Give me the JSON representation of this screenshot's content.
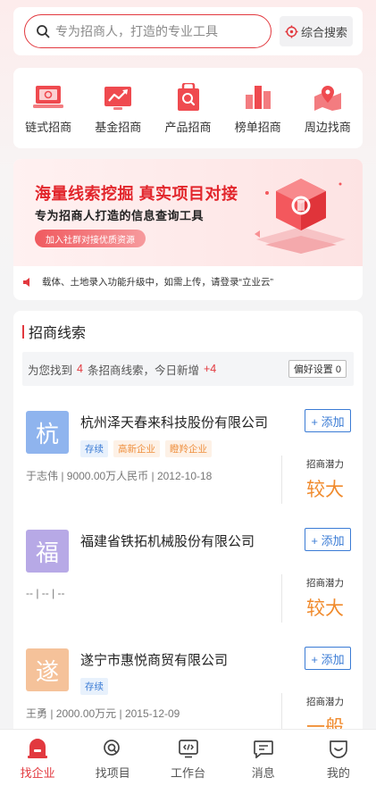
{
  "search": {
    "placeholder": "专为招商人，打造的专业工具",
    "combo_label": "综合搜索"
  },
  "categories": [
    {
      "label": "链式招商",
      "icon": "laptop-icon"
    },
    {
      "label": "基金招商",
      "icon": "trend-chart-icon"
    },
    {
      "label": "产品招商",
      "icon": "product-search-icon"
    },
    {
      "label": "榜单招商",
      "icon": "bar-chart-icon"
    },
    {
      "label": "周边找商",
      "icon": "map-pin-icon"
    }
  ],
  "banner": {
    "title": "海量线索挖掘 真实项目对接",
    "subtitle": "专为招商人打造的信息查询工具",
    "button_label": "加入社群对接优质资源",
    "notice": "载体、土地录入功能升级中，如需上传，请登录“立业云”"
  },
  "leads": {
    "section_title": "招商线索",
    "summary_prefix": "为您找到",
    "found_count": "4",
    "summary_middle": "条招商线索，今日新增",
    "new_count": "+4",
    "pref_button": "偏好设置 0",
    "add_label": "+ 添加",
    "potential_label": "招商潜力",
    "items": [
      {
        "avatar_char": "杭",
        "avatar_color": "#8fb4ee",
        "name": "杭州泽天春来科技股份有限公司",
        "tags": [
          "存续",
          "高新企业",
          "瞪羚企业"
        ],
        "meta": "于志伟 | 9000.00万人民币 | 2012-10-18",
        "potential": "较大"
      },
      {
        "avatar_char": "福",
        "avatar_color": "#b7a9e6",
        "name": "福建省铁拓机械股份有限公司",
        "tags": [],
        "meta": "-- | -- | --",
        "potential": "较大"
      },
      {
        "avatar_char": "遂",
        "avatar_color": "#f5c29a",
        "name": "遂宁市惠悦商贸有限公司",
        "tags": [
          "存续"
        ],
        "meta": "王勇 | 2000.00万元 | 2015-12-09",
        "potential": "一般"
      }
    ]
  },
  "tabbar": [
    {
      "label": "找企业",
      "icon": "company-icon",
      "active": true
    },
    {
      "label": "找项目",
      "icon": "project-search-icon",
      "active": false
    },
    {
      "label": "工作台",
      "icon": "workbench-icon",
      "active": false
    },
    {
      "label": "消息",
      "icon": "message-icon",
      "active": false
    },
    {
      "label": "我的",
      "icon": "profile-icon",
      "active": false
    }
  ],
  "colors": {
    "accent": "#e2393f",
    "link_blue": "#3a7bd5",
    "potential_orange": "#f08a2c"
  }
}
